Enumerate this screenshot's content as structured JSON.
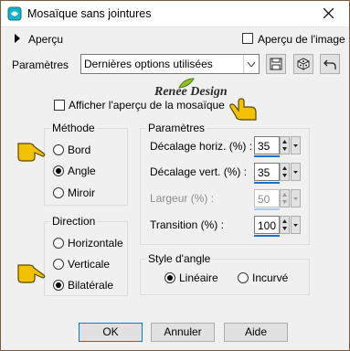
{
  "window": {
    "title": "Mosaïque sans jointures"
  },
  "preview": {
    "label": "Aperçu",
    "image_preview_label": "Aperçu de l'image",
    "show_tile_preview_label": "Afficher l'aperçu de la mosaïque"
  },
  "settings": {
    "label": "Paramètres",
    "value": "Dernières options utilisées"
  },
  "watermark": {
    "text": "Renée Design"
  },
  "method": {
    "legend": "Méthode",
    "options": [
      "Bord",
      "Angle",
      "Miroir"
    ],
    "selected": "Angle"
  },
  "direction": {
    "legend": "Direction",
    "options": [
      "Horizontale",
      "Verticale",
      "Bilatérale"
    ],
    "selected": "Bilatérale"
  },
  "params": {
    "legend": "Paramètres",
    "horizontal_offset": {
      "label": "Décalage horiz. (%) :",
      "value": "35"
    },
    "vertical_offset": {
      "label": "Décalage vert. (%) :",
      "value": "35"
    },
    "width": {
      "label": "Largeur (%) :",
      "value": "50",
      "disabled": true
    },
    "transition": {
      "label": "Transition (%) :",
      "value": "100"
    }
  },
  "corner_style": {
    "legend": "Style d'angle",
    "options": [
      "Linéaire",
      "Incurvé"
    ],
    "selected": "Linéaire"
  },
  "buttons": {
    "ok": "OK",
    "cancel": "Annuler",
    "help": "Aide"
  },
  "colors": {
    "accent": "#0078d7",
    "slider_bar": "#1a6fcf",
    "hand_yellow": "#f2c200"
  }
}
